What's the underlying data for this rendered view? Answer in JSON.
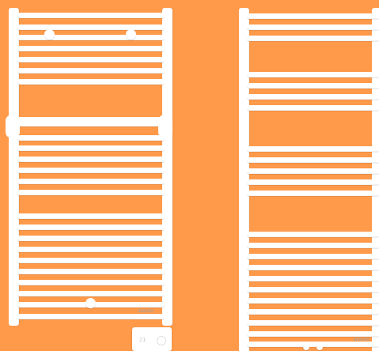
{
  "scene": {
    "background": "#ff9a4a",
    "radiator_color": "#ffffff",
    "shadow_color": "#e8e8e8",
    "left_radiator": {
      "brand_text": "atlantic",
      "controller_display": "21",
      "towel_bar": true,
      "knob_count": 3
    },
    "right_radiator": {
      "brand_text": "atlantic",
      "knob_count": 2
    }
  }
}
